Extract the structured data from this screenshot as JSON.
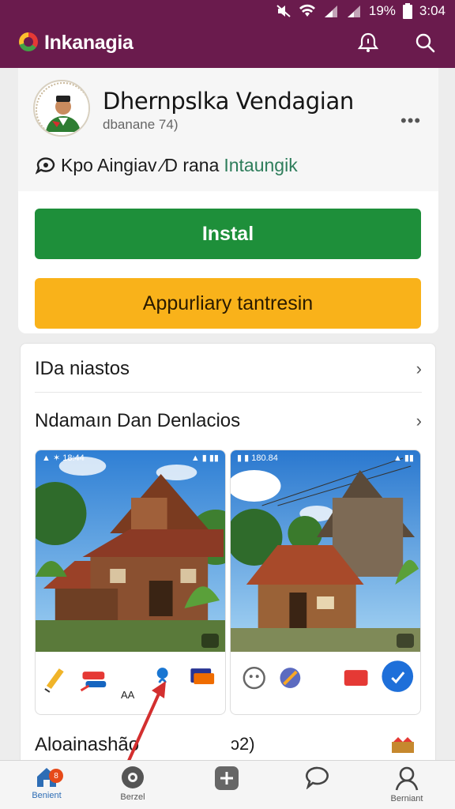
{
  "status_bar": {
    "battery": "19%",
    "time": "3:04"
  },
  "app_bar": {
    "title": "Inkanagia",
    "icons": [
      "notification-bell-icon",
      "search-icon"
    ]
  },
  "app": {
    "name": "Dhernpslka Vendagian",
    "subtitle": "dbanane 74)",
    "meta_part1": "Kpo Aingiav",
    "meta_part2": "∕D rana",
    "meta_link": "Intaungik",
    "install_label": "Instal",
    "secondary_label": "Appurliary tantresin"
  },
  "sections": [
    {
      "label": "IDa niastos"
    },
    {
      "label": "Ndamaın Dan Denlacios"
    }
  ],
  "screenshots": [
    {
      "status_left": "▲ ✶ 18:44",
      "status_right": "▲ ▮ ▮▮"
    },
    {
      "status_left": "▮ ▮ 180.84",
      "status_right": "▲ ▮▮"
    }
  ],
  "small_label": "AA",
  "row3": {
    "label": "Aloainashão",
    "mid": "ᴐ2)"
  },
  "bottom_nav": [
    {
      "label": "Benient",
      "icon": "home-icon",
      "active": true,
      "badge": "8"
    },
    {
      "label": "Berzel",
      "icon": "disc-icon",
      "active": false
    },
    {
      "label": "",
      "icon": "add-icon",
      "active": false
    },
    {
      "label": "",
      "icon": "chat-icon",
      "active": false
    },
    {
      "label": "Berniant",
      "icon": "profile-icon",
      "active": false
    }
  ],
  "colors": {
    "appbar": "#6a1b4d",
    "install": "#1e8f3a",
    "secondary": "#f9b21a",
    "link": "#2e7d5b",
    "nav_active": "#2d6db5"
  }
}
